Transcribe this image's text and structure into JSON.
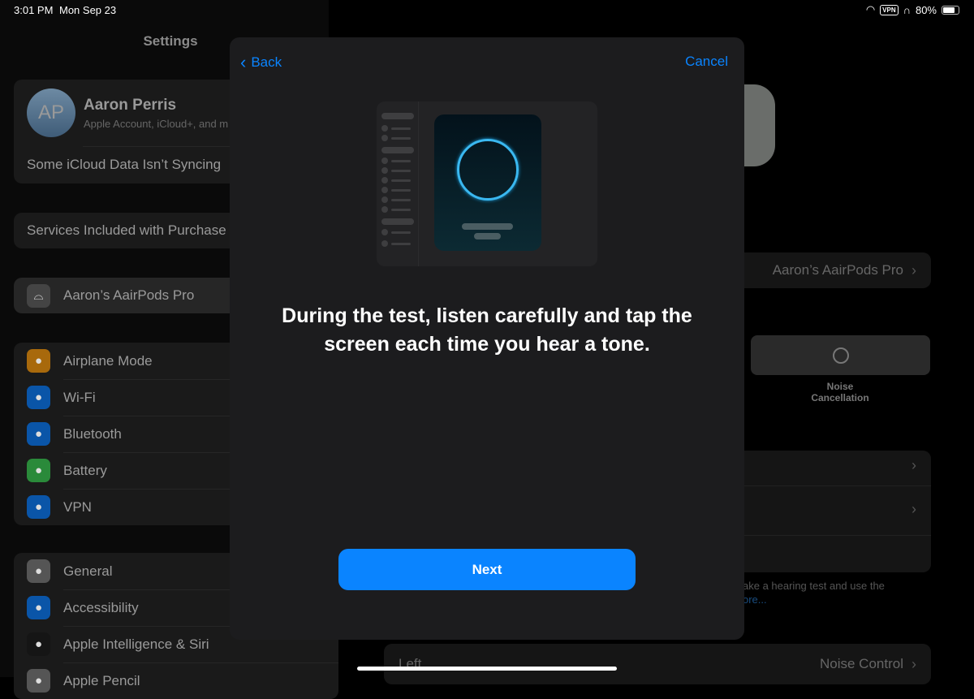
{
  "status": {
    "time": "3:01 PM",
    "date": "Mon Sep 23",
    "vpn": "VPN",
    "battery": "80%",
    "battery_level": 0.8
  },
  "sidebar": {
    "title": "Settings",
    "profile": {
      "initials": "AP",
      "name": "Aaron Perris",
      "subtitle": "Apple Account, iCloud+, and m",
      "alert": "Some iCloud Data Isn’t Syncing"
    },
    "services": "Services Included with Purchase",
    "device": "Aaron’s AairPods Pro",
    "group1": [
      {
        "label": "Airplane Mode",
        "icon": "airplane-icon",
        "color": "#a8690c"
      },
      {
        "label": "Wi-Fi",
        "icon": "wifi-icon",
        "color": "#0a55a8"
      },
      {
        "label": "Bluetooth",
        "icon": "bluetooth-icon",
        "color": "#0a55a8"
      },
      {
        "label": "Battery",
        "icon": "battery-icon",
        "color": "#2a8a3a"
      },
      {
        "label": "VPN",
        "icon": "globe-icon",
        "color": "#0a55a8"
      }
    ],
    "group2": [
      {
        "label": "General",
        "icon": "gear-icon",
        "color": "#555"
      },
      {
        "label": "Accessibility",
        "icon": "accessibility-icon",
        "color": "#0a55a8"
      },
      {
        "label": "Apple Intelligence & Siri",
        "icon": "siri-icon",
        "color": "#151515"
      },
      {
        "label": "Apple Pencil",
        "icon": "pencil-icon",
        "color": "#555"
      }
    ]
  },
  "detail": {
    "device_row": "Aaron’s AairPods Pro",
    "mode": "Noise Cancellation",
    "footer1": "ake a hearing test and use the",
    "footer2": "ore...",
    "bottom_left": "Left",
    "bottom_right": "Noise Control"
  },
  "modal": {
    "back": "Back",
    "cancel": "Cancel",
    "headline": "During the test, listen carefully and tap the screen each time you hear a tone.",
    "next": "Next",
    "accent": "#0a84ff"
  }
}
